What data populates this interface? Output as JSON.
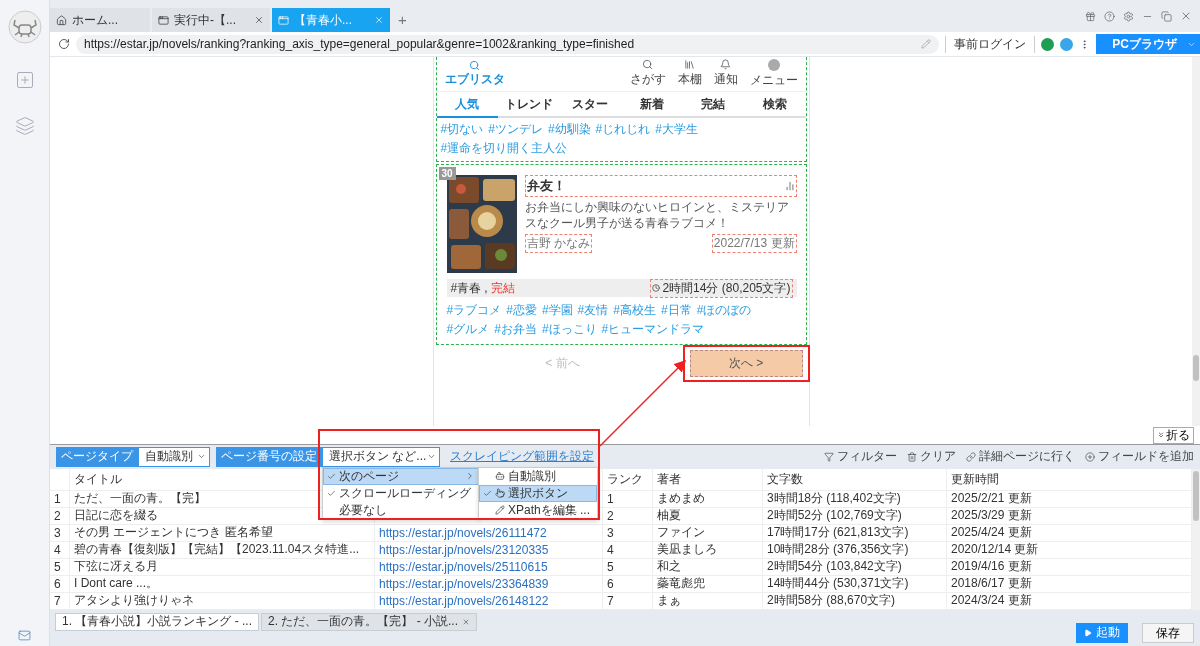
{
  "app_tabs": [
    {
      "label": "ホーム...",
      "kind": "home",
      "selected": false,
      "closable": false
    },
    {
      "label": "実行中-【...",
      "kind": "page",
      "selected": false,
      "closable": true
    },
    {
      "label": "【青春小...",
      "kind": "page",
      "selected": true,
      "closable": true
    }
  ],
  "new_tab": "+",
  "address_bar": {
    "url": "https://estar.jp/novels/ranking?ranking_axis_type=general_popular&genre=1002&ranking_type=finished",
    "login": "事前ログイン",
    "browser_mode": "PCブラウザ"
  },
  "site": {
    "logo": "エブリスタ",
    "header_icons": [
      {
        "kind": "search",
        "label": "さがす"
      },
      {
        "kind": "shelf",
        "label": "本棚"
      },
      {
        "kind": "bell",
        "label": "通知"
      },
      {
        "kind": "avatar",
        "label": "メニュー"
      }
    ],
    "nav": [
      {
        "label": "人気",
        "selected": true
      },
      {
        "label": "トレンド",
        "selected": false
      },
      {
        "label": "スター",
        "selected": false
      },
      {
        "label": "新着",
        "selected": false
      },
      {
        "label": "完結",
        "selected": false
      },
      {
        "label": "検索",
        "selected": false
      }
    ],
    "tags_above": [
      "#切ない",
      "#ツンデレ",
      "#幼馴染",
      "#じれじれ",
      "#大学生",
      "#運命を切り開く主人公"
    ],
    "card": {
      "rank": "30",
      "kind": "picture",
      "title": "弁友！",
      "description": "お弁当にしか興味のないヒロインと、ミステリアスなクール男子が送る青春ラブコメ！",
      "author": "吉野 かなみ",
      "updated": "2022/7/13 更新",
      "genre": "#青春",
      "separator": ",",
      "status": "完結",
      "reading_time": "2時間14分 (80,205文字)",
      "tags": [
        "#ラブコメ",
        "#恋愛",
        "#学園",
        "#友情",
        "#高校生",
        "#日常",
        "#ほのぼの",
        "#グルメ",
        "#お弁当",
        "#ほっこり",
        "#ヒューマンドラマ"
      ]
    },
    "pagination": {
      "prev": "< 前へ",
      "prev_disabled": true,
      "next": "次へ >"
    }
  },
  "collapse_button": "折る",
  "toolbar": {
    "page_type_label": "ページタイプ",
    "page_type": "自動識別",
    "paging_label": "ページ番号の設定",
    "paging": "選択ボタン など...",
    "scope_link": "スクレイピング範囲を設定",
    "actions": [
      {
        "kind": "filter",
        "label": "フィルター"
      },
      {
        "kind": "clear",
        "label": "クリア"
      },
      {
        "kind": "link",
        "label": "詳細ページに行く"
      },
      {
        "kind": "add",
        "label": "フィールドを追加"
      }
    ]
  },
  "paging_menu": {
    "items": [
      {
        "label": "次のページ",
        "checked": true,
        "selected": true,
        "submenu": true
      },
      {
        "label": "スクロールローディング",
        "checked": true,
        "selected": false,
        "submenu": false
      },
      {
        "label": "必要なし",
        "checked": false,
        "selected": false,
        "submenu": false
      }
    ],
    "submenu": [
      {
        "kind": "auto",
        "label": "自動識別",
        "checked": false,
        "selected": false
      },
      {
        "kind": "click",
        "label": "選択ボタン",
        "checked": true,
        "selected": true
      },
      {
        "kind": "xpath",
        "label": "XPathを編集 ...",
        "checked": false,
        "selected": false
      }
    ]
  },
  "table": {
    "columns": {
      "title": "タイトル",
      "rank": "ランク",
      "author": "著者",
      "length": "文字数",
      "updated": "更新時間"
    },
    "rows": [
      {
        "index": "1",
        "title": "ただ、一面の青。【完】",
        "rank": "1",
        "author": "まめまめ",
        "length": "3時間18分 (118,402文字)",
        "updated": "2025/2/21 更新"
      },
      {
        "index": "2",
        "title": "日記に恋を綴る",
        "rank": "2",
        "author": "柚夏",
        "length": "2時間52分 (102,769文字)",
        "updated": "2025/3/29 更新"
      },
      {
        "index": "3",
        "title": "その男 エージェントにつき 匿名希望",
        "column_3": "https://estar.jp/novels/26111472",
        "rank": "3",
        "author": "ファイン",
        "length": "17時間17分 (621,813文字)",
        "updated": "2025/4/24 更新"
      },
      {
        "index": "4",
        "title": "碧の青春【復刻版】【完結】【2023.11.04スタ特進...",
        "column_3": "https://estar.jp/novels/23120335",
        "rank": "4",
        "author": "美凪ましろ",
        "length": "10時間28分 (376,356文字)",
        "updated": "2020/12/14 更新"
      },
      {
        "index": "5",
        "title": "下弦に冴える月",
        "column_3": "https://estar.jp/novels/25110615",
        "rank": "5",
        "author": "和之",
        "length": "2時間54分 (103,842文字)",
        "updated": "2019/4/16 更新"
      },
      {
        "index": "6",
        "title": "I Dont care ...。",
        "column_3": "https://estar.jp/novels/23364839",
        "rank": "6",
        "author": "蘂竜彪兜",
        "length": "14時間44分 (530,371文字)",
        "updated": "2018/6/17 更新"
      },
      {
        "index": "7",
        "title": "アタシより強けりゃネ",
        "column_3": "https://estar.jp/novels/26148122",
        "rank": "7",
        "author": "まぁ",
        "length": "2時間58分 (88,670文字)",
        "updated": "2024/3/24 更新"
      }
    ]
  },
  "task_tabs": [
    {
      "label": "1. 【青春小説】小説ランキング - ...",
      "selected": true,
      "closable": false
    },
    {
      "label": "2. ただ、一面の青。【完】 - 小説...",
      "selected": false,
      "closable": true
    }
  ],
  "run_button": "起動",
  "save_button": "保存"
}
